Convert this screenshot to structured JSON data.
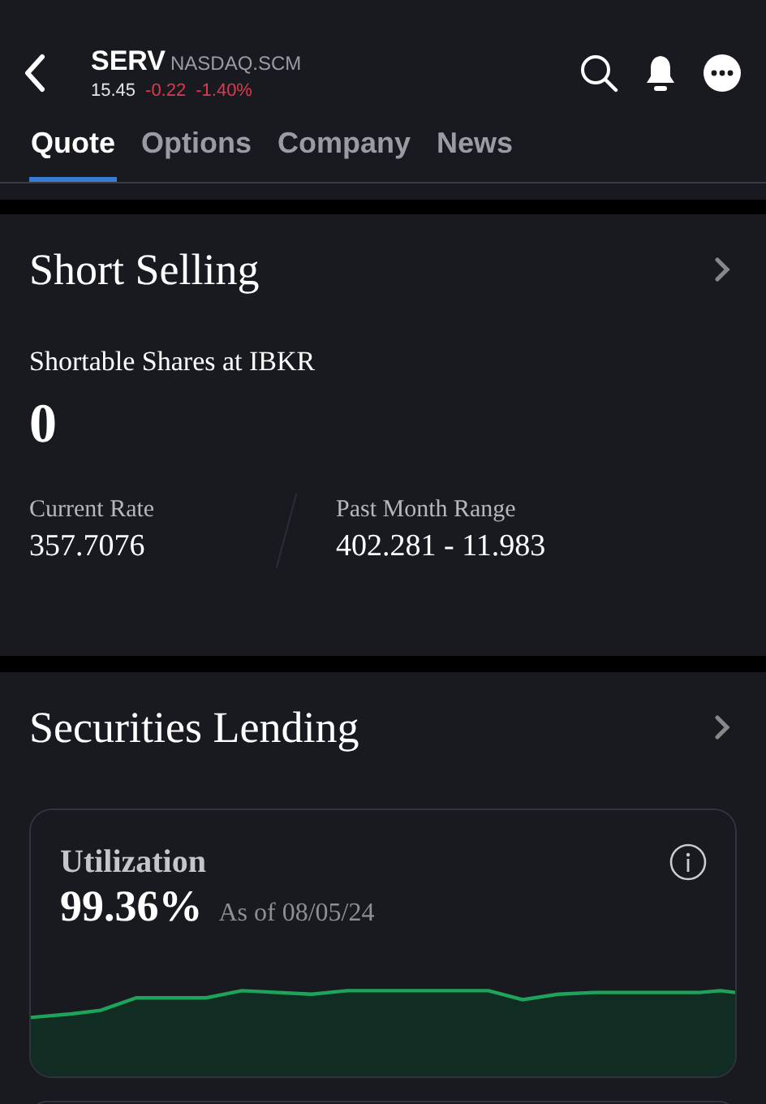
{
  "header": {
    "symbol": "SERV",
    "exchange": "NASDAQ.SCM",
    "price": "15.45",
    "change": "-0.22",
    "change_percent": "-1.40%"
  },
  "tabs": [
    {
      "label": "Quote",
      "selected": true
    },
    {
      "label": "Options",
      "selected": false
    },
    {
      "label": "Company",
      "selected": false
    },
    {
      "label": "News",
      "selected": false
    }
  ],
  "short_selling": {
    "title": "Short Selling",
    "shortable_label": "Shortable Shares at IBKR",
    "shortable_value": "0",
    "stats": [
      {
        "label": "Current Rate",
        "value": "357.7076"
      },
      {
        "label": "Past Month Range",
        "value": "402.281 - 11.983"
      }
    ]
  },
  "securities_lending": {
    "title": "Securities Lending",
    "utilization": {
      "title": "Utilization",
      "value": "99.36%",
      "as_of": "As of 08/05/24"
    }
  }
}
